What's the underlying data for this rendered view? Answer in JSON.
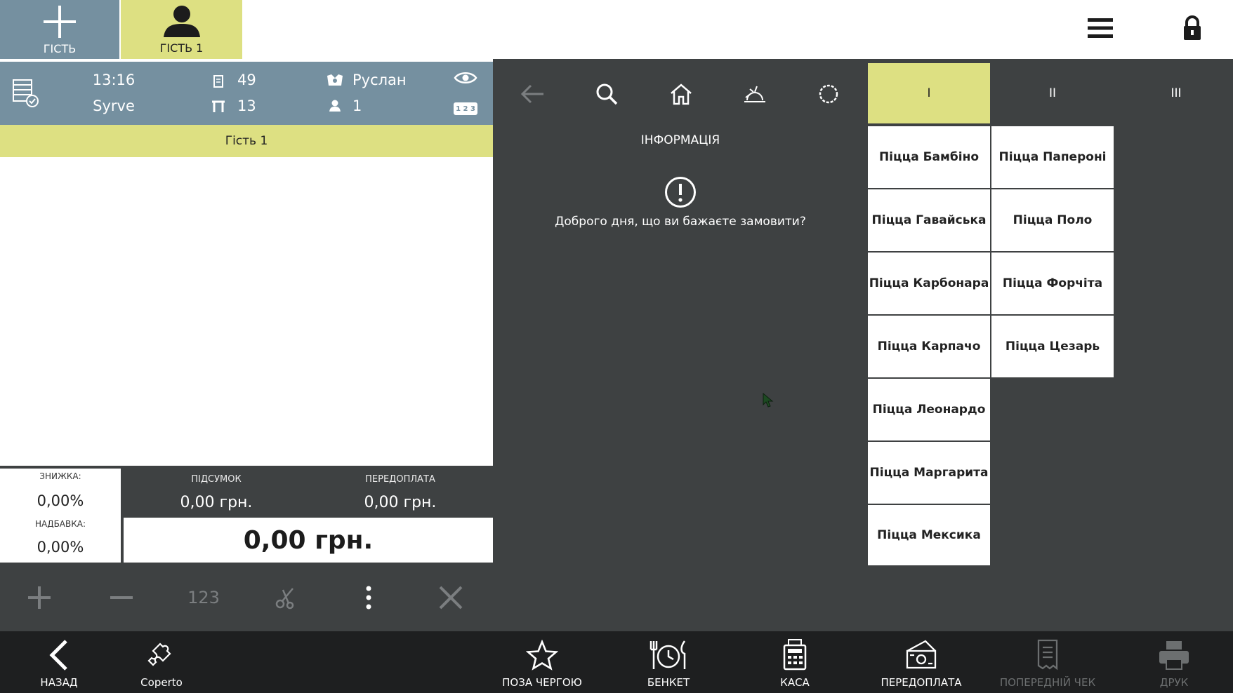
{
  "topbar": {
    "add_guest_label": "ГІСТЬ",
    "guest_tab_label": "ГІСТЬ 1"
  },
  "order": {
    "time": "13:16",
    "restaurant": "Syrve",
    "order_number": "49",
    "table_number": "13",
    "waiter": "Руслан",
    "guests_count": "1",
    "numpad_badge": "1 2 3",
    "guest_strip": "Гість 1"
  },
  "totals": {
    "discount_label": "ЗНИЖКА:",
    "discount_value": "0,00%",
    "surcharge_label": "НАДБАВКА:",
    "surcharge_value": "0,00%",
    "subtotal_label": "ПІДСУМОК",
    "subtotal_value": "0,00 грн.",
    "prepay_label": "ПЕРЕДОПЛАТА",
    "prepay_value": "0,00 грн.",
    "grand_total": "0,00 грн."
  },
  "actions": {
    "qty_label": "123"
  },
  "info": {
    "title": "ІНФОРМАЦІЯ",
    "message": "Доброго дня, що ви бажаєте замовити?"
  },
  "categories": [
    {
      "label": "I"
    },
    {
      "label": "II"
    },
    {
      "label": "III"
    }
  ],
  "products_col1": [
    "Піцца Бамбіно",
    "Піцца Гавайська",
    "Піцца Карбонара",
    "Піцца Карпачо",
    "Піцца Леонардо",
    "Піцца Маргарита",
    "Піцца Мексика"
  ],
  "products_col2": [
    "Піцца Папероні",
    "Піцца Поло",
    "Піцца Форчіта",
    "Піцца Цезарь"
  ],
  "bottom": {
    "back": "НАЗАД",
    "coperto": "Coperto",
    "out_of_turn": "ПОЗА ЧЕРГОЮ",
    "banquet": "БЕНКЕТ",
    "cash": "КАСА",
    "prepayment": "ПЕРЕДОПЛАТА",
    "precheck": "ПОПЕРЕДНІЙ ЧЕК",
    "print": "ДРУК"
  },
  "colors": {
    "accent": "#dde082",
    "header_blue": "#7590a0",
    "panel_dark": "#3e4142",
    "bottom_bar": "#1e1f20"
  }
}
